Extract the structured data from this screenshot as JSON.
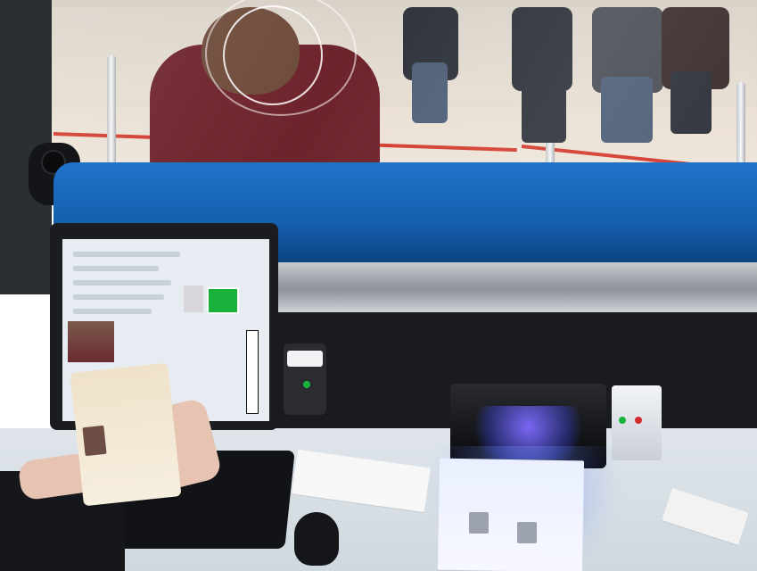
{
  "scene": {
    "description": "",
    "colors": {
      "counter_blue": "#1f73c8",
      "hoodie_maroon": "#6b1f27",
      "scanner_glow": "#3f4eff",
      "screen_green": "#18b23b",
      "floor_red_line": "#d23a2c"
    },
    "icons": [
      "camera-icon",
      "monitor-icon",
      "keyboard-icon",
      "mouse-icon",
      "scanner-icon",
      "passport-icon"
    ]
  }
}
